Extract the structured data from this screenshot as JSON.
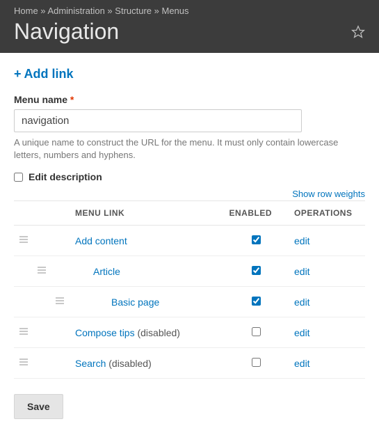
{
  "breadcrumb": {
    "items": [
      "Home",
      "Administration",
      "Structure",
      "Menus"
    ],
    "sep": " » "
  },
  "page_title": "Navigation",
  "add_link_label": "Add link",
  "menu_name": {
    "label": "Menu name",
    "required": "*",
    "value": "navigation",
    "description": "A unique name to construct the URL for the menu. It must only contain lowercase letters, numbers and hyphens."
  },
  "edit_description": {
    "label": "Edit description",
    "checked": false
  },
  "show_weights_label": "Show row weights",
  "table": {
    "headers": {
      "menu_link": "MENU LINK",
      "enabled": "ENABLED",
      "operations": "OPERATIONS"
    },
    "rows": [
      {
        "label": "Add content",
        "suffix": "",
        "enabled": true,
        "indent": 0,
        "op": "edit"
      },
      {
        "label": "Article",
        "suffix": "",
        "enabled": true,
        "indent": 1,
        "op": "edit"
      },
      {
        "label": "Basic page",
        "suffix": "",
        "enabled": true,
        "indent": 2,
        "op": "edit"
      },
      {
        "label": "Compose tips",
        "suffix": " (disabled)",
        "enabled": false,
        "indent": 0,
        "op": "edit"
      },
      {
        "label": "Search",
        "suffix": " (disabled)",
        "enabled": false,
        "indent": 0,
        "op": "edit"
      }
    ]
  },
  "save_label": "Save"
}
